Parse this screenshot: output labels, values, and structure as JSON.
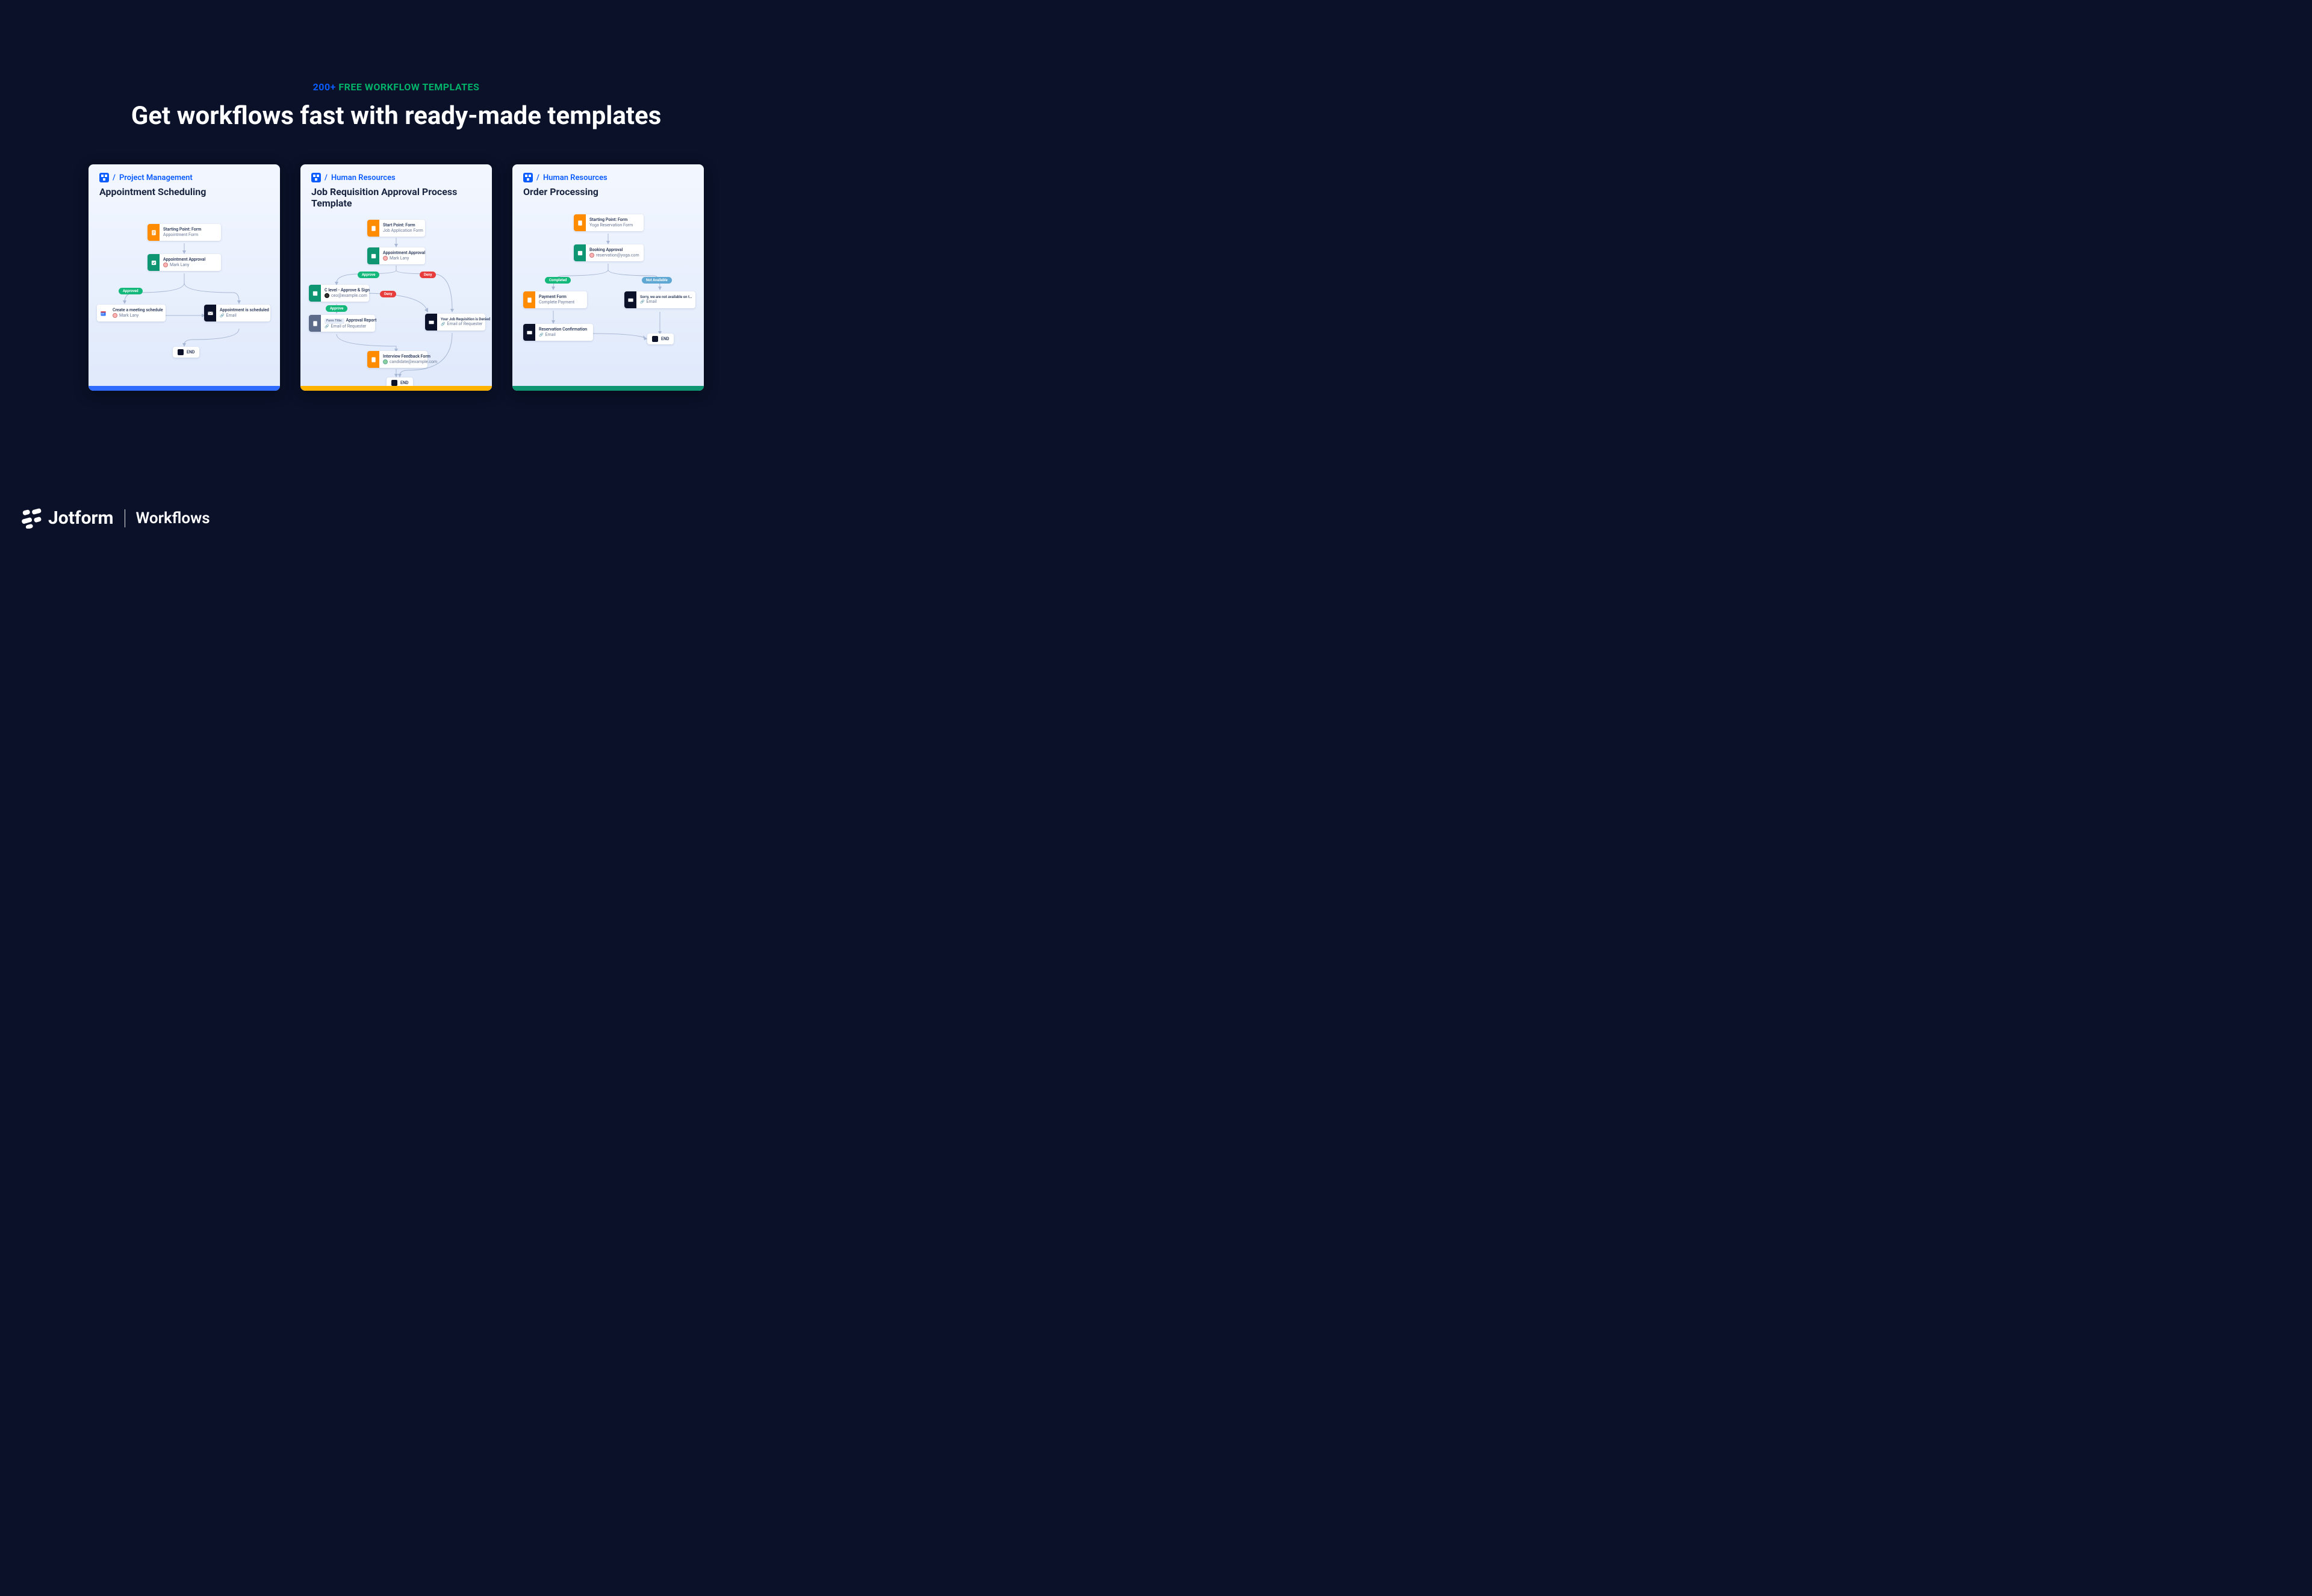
{
  "header": {
    "eyebrow_count": "200+",
    "eyebrow_text": "FREE WORKFLOW TEMPLATES",
    "title": "Get workflows fast with ready-made templates"
  },
  "cards": [
    {
      "category": "Project Management",
      "title": "Appointment Scheduling",
      "accent": "#2f6bff",
      "nodes": {
        "start_l1": "Starting Point: Form",
        "start_l2": "Appointment Form",
        "approval_l1": "Appointment Approval",
        "approval_l2": "Mark Lany",
        "approved_pill": "Approved",
        "meeting_l1": "Create a meeting schedule",
        "meeting_l2": "Mark Lany",
        "sched_l1": "Appointment is scheduled",
        "sched_l2": "Email",
        "end": "END"
      }
    },
    {
      "category": "Human Resources",
      "title": "Job Requisition Approval Process Template",
      "accent": "#ffb300",
      "nodes": {
        "start_l1": "Start Point: Form",
        "start_l2": "Job Application Form",
        "approval_l1": "Appointment Approval",
        "approval_l2": "Mark Lany",
        "approve_pill": "Approve",
        "deny_pill": "Deny",
        "clevel_l1": "C level - Approve & Sign",
        "clevel_l2": "ceo@example.com",
        "deny2_pill": "Deny",
        "approve2_pill": "Approve",
        "doc_tag": "Form Title:",
        "doc_l1": "Approval Report",
        "doc_l2": "Email of Requester",
        "denied_l1": "Your Job Requisition is Denied",
        "denied_l2": "Email of Requester",
        "feedback_l1": "Interview Feedback Form",
        "feedback_l2": "candidate@example.com",
        "end": "END"
      }
    },
    {
      "category": "Human Resources",
      "title": "Order Processing",
      "accent": "#0e9673",
      "nodes": {
        "start_l1": "Starting Point: Form",
        "start_l2": "Yoga Reservation Form",
        "approval_l1": "Booking Approval",
        "approval_l2": "reservation@yoga.com",
        "completed_pill": "Completed",
        "na_pill": "Not Available",
        "pay_l1": "Payment Form",
        "pay_l2": "Complete Payment",
        "sorry_l1": "Sorry, we are not available on t…",
        "sorry_l2": "Email",
        "conf_l1": "Reservation Confirmation",
        "conf_l2": "Email",
        "end": "END"
      }
    }
  ],
  "footer": {
    "brand": "Jotform",
    "product": "Workflows"
  },
  "colors": {
    "approve": "#14b87a",
    "deny": "#e73d3d",
    "completed": "#14b87a",
    "na": "#5fa8d3"
  }
}
